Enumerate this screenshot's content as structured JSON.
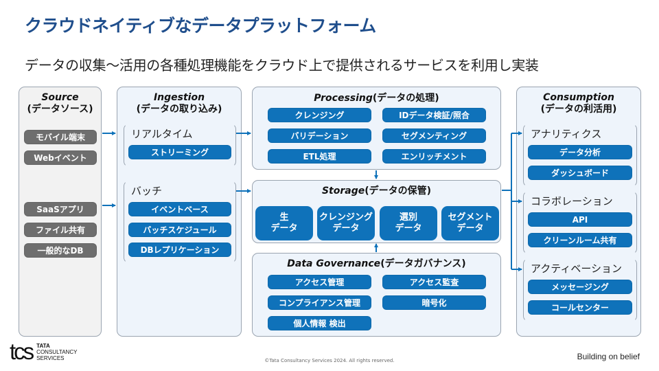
{
  "title": "クラウドネイティブなデータプラットフォーム",
  "subtitle": "データの収集～活用の各種処理機能をクラウド上で提供されるサービスを利用し実装",
  "colors": {
    "title": "#1f4e8c",
    "pill_blue": "#0f72ba",
    "pill_gray": "#6e6e6e",
    "arrow": "#0f72ba"
  },
  "source": {
    "title_en": "Source",
    "title_jp": "(データソース)",
    "items": [
      "モバイル端末",
      "Webイベント",
      "SaaSアプリ",
      "ファイル共有",
      "一般的なDB"
    ]
  },
  "ingestion": {
    "title_en": "Ingestion",
    "title_jp": "(データの取り込み)",
    "groups": [
      {
        "label": "リアルタイム",
        "items": [
          "ストリーミング"
        ]
      },
      {
        "label": "バッチ",
        "items": [
          "イベントベース",
          "バッチスケジュール",
          "DBレプリケーション"
        ]
      }
    ]
  },
  "processing": {
    "title_en": "Processing",
    "title_jp": "(データの処理)",
    "items": [
      "クレンジング",
      "IDデータ検証/照合",
      "バリデーション",
      "セグメンティング",
      "ETL処理",
      "エンリッチメント"
    ]
  },
  "storage": {
    "title_en": "Storage",
    "title_jp": "(データの保管)",
    "items": [
      {
        "line1": "生",
        "line2": "データ"
      },
      {
        "line1": "クレンジング",
        "line2": "データ"
      },
      {
        "line1": "選別",
        "line2": "データ"
      },
      {
        "line1": "セグメント",
        "line2": "データ"
      }
    ]
  },
  "governance": {
    "title_en": "Data Governance",
    "title_jp": "(データガバナンス)",
    "items": [
      "アクセス管理",
      "アクセス監査",
      "コンプライアンス管理",
      "暗号化",
      "個人情報 検出"
    ]
  },
  "consumption": {
    "title_en": "Consumption",
    "title_jp": "(データの利活用)",
    "groups": [
      {
        "label": "アナリティクス",
        "items": [
          "データ分析",
          "ダッシュボード"
        ]
      },
      {
        "label": "コラボレーション",
        "items": [
          "API",
          "クリーンルーム共有"
        ]
      },
      {
        "label": "アクティベーション",
        "items": [
          "メッセージング",
          "コールセンター"
        ]
      }
    ]
  },
  "footer": {
    "logo_mark": "tcs",
    "logo_line1": "TATA",
    "logo_line2": "CONSULTANCY",
    "logo_line3": "SERVICES",
    "copyright": "©Tata Consultancy Services 2024.  All rights reserved.",
    "tagline": "Building on belief"
  }
}
